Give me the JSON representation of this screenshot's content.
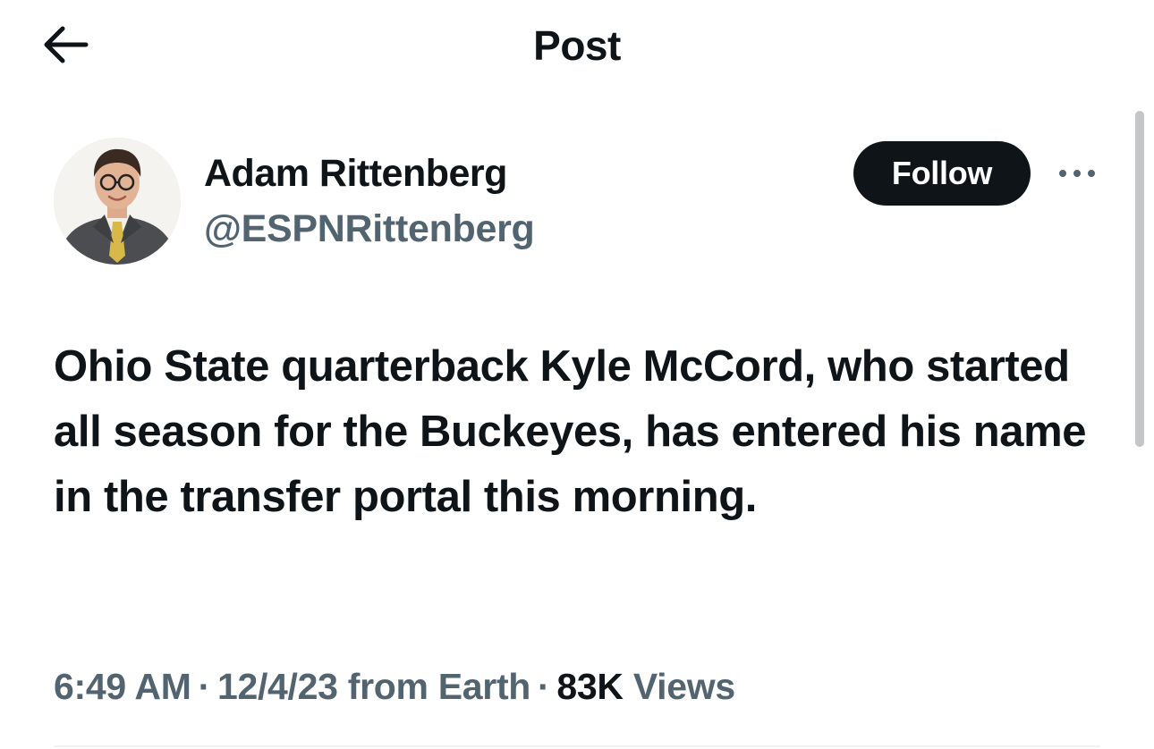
{
  "header": {
    "title": "Post",
    "back_icon": "arrow-left-icon"
  },
  "author": {
    "name": "Adam Rittenberg",
    "handle": "@ESPNRittenberg",
    "avatar_icon": "profile-photo"
  },
  "actions": {
    "follow_label": "Follow",
    "more_icon": "more-horizontal-icon"
  },
  "post": {
    "text": "Ohio State quarterback Kyle McCord, who started all season for the Buckeyes, has entered his name in the transfer portal this morning."
  },
  "meta": {
    "time": "6:49 AM",
    "separator": "·",
    "date_location": "12/4/23 from Earth",
    "views_count": "83K",
    "views_label": "Views"
  },
  "colors": {
    "primary_text": "#0f1419",
    "secondary_text": "#536471",
    "follow_bg": "#0f1419",
    "follow_text": "#ffffff",
    "divider": "#eff3f4"
  }
}
